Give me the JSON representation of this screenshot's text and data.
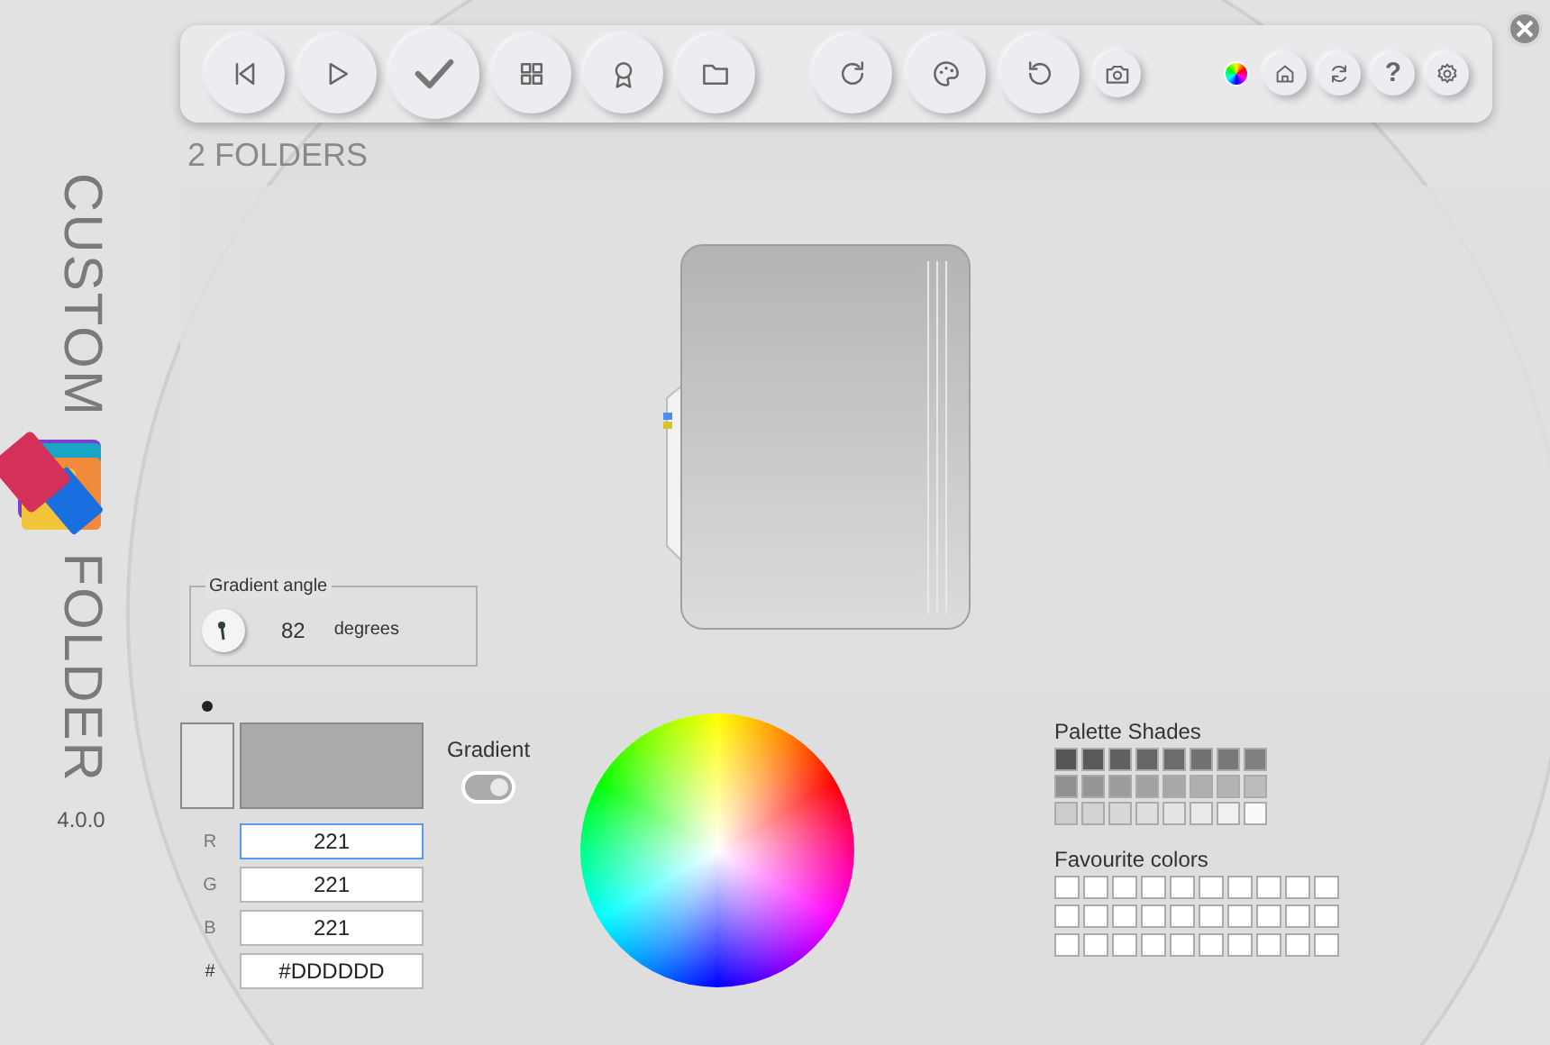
{
  "app": {
    "title": "CUSTOM FOLDER",
    "version": "4.0.0"
  },
  "toolbar_groups": [
    [
      {
        "kind": "round"
      },
      {
        "kind": "round"
      },
      {
        "kind": "primary"
      },
      {
        "kind": "round"
      },
      {
        "kind": "round"
      },
      {
        "kind": "round"
      }
    ],
    [
      {
        "kind": "round"
      },
      {
        "kind": "round"
      },
      {
        "kind": "round"
      },
      {
        "kind": "small"
      }
    ],
    [
      {
        "kind": "plain"
      },
      {
        "kind": "mini"
      },
      {
        "kind": "mini"
      },
      {
        "kind": "mini",
        "label": "?"
      },
      {
        "kind": "mini"
      }
    ]
  ],
  "heading": "2 FOLDERS",
  "gradient_angle": {
    "legend": "Gradient angle",
    "value": "82",
    "unit": "degrees"
  },
  "swatches": [
    {
      "color": "#e4e4e4",
      "selected": true
    },
    {
      "color": "#aaaaaa",
      "selected": false
    }
  ],
  "fields": [
    {
      "label": "R",
      "value": "221",
      "focused": true
    },
    {
      "label": "G",
      "value": "221",
      "focused": false
    },
    {
      "label": "B",
      "value": "221",
      "focused": false
    },
    {
      "label": "#",
      "value": "#DDDDDD",
      "focused": false
    }
  ],
  "gradient": {
    "label": "Gradient",
    "on": true
  },
  "palette_shades": {
    "title": "Palette Shades",
    "swatches": [
      {
        "color": "#555555"
      },
      {
        "color": "#5a5a5a"
      },
      {
        "color": "#606060"
      },
      {
        "color": "#666666"
      },
      {
        "color": "#6c6c6c"
      },
      {
        "color": "#727272"
      },
      {
        "color": "#787878"
      },
      {
        "color": "#808080"
      },
      {
        "color": "#909090"
      },
      {
        "color": "#969696"
      },
      {
        "color": "#9c9c9c"
      },
      {
        "color": "#a2a2a2"
      },
      {
        "color": "#a8a8a8"
      },
      {
        "color": "#aeaeae"
      },
      {
        "color": "#b4b4b4"
      },
      {
        "color": "#bcbcbc"
      },
      {
        "color": "#cccccc"
      },
      {
        "color": "#d2d2d2"
      },
      {
        "color": "#d8d8d8"
      },
      {
        "color": "#dedede"
      },
      {
        "color": "#e4e4e4"
      },
      {
        "color": "#eaeaea"
      },
      {
        "color": "#f0f0f0"
      },
      {
        "color": "#fafafa"
      }
    ]
  },
  "favourite_colors": {
    "title": "Favourite colors",
    "swatches": [
      {
        "color": "#ffffff"
      },
      {
        "color": "#ffffff"
      },
      {
        "color": "#ffffff"
      },
      {
        "color": "#ffffff"
      },
      {
        "color": "#ffffff"
      },
      {
        "color": "#ffffff"
      },
      {
        "color": "#ffffff"
      },
      {
        "color": "#ffffff"
      },
      {
        "color": "#ffffff"
      },
      {
        "color": "#ffffff"
      },
      {
        "color": "#ffffff"
      },
      {
        "color": "#ffffff"
      },
      {
        "color": "#ffffff"
      },
      {
        "color": "#ffffff"
      },
      {
        "color": "#ffffff"
      },
      {
        "color": "#ffffff"
      },
      {
        "color": "#ffffff"
      },
      {
        "color": "#ffffff"
      },
      {
        "color": "#ffffff"
      },
      {
        "color": "#ffffff"
      },
      {
        "color": "#ffffff"
      },
      {
        "color": "#ffffff"
      },
      {
        "color": "#ffffff"
      },
      {
        "color": "#ffffff"
      },
      {
        "color": "#ffffff"
      },
      {
        "color": "#ffffff"
      },
      {
        "color": "#ffffff"
      },
      {
        "color": "#ffffff"
      },
      {
        "color": "#ffffff"
      },
      {
        "color": "#ffffff"
      }
    ]
  }
}
